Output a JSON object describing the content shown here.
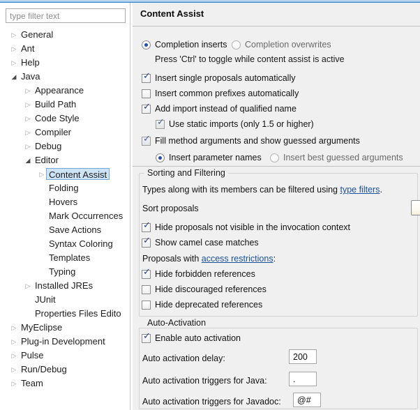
{
  "window": {
    "title_strip_color": "#5f9fd4"
  },
  "sidebar": {
    "filter": {
      "placeholder": "type filter text",
      "value": ""
    },
    "items": [
      {
        "label": "General",
        "level": 0,
        "twisty": "collapsed",
        "selected": false
      },
      {
        "label": "Ant",
        "level": 0,
        "twisty": "collapsed",
        "selected": false
      },
      {
        "label": "Help",
        "level": 0,
        "twisty": "collapsed",
        "selected": false
      },
      {
        "label": "Java",
        "level": 0,
        "twisty": "expanded",
        "selected": false
      },
      {
        "label": "Appearance",
        "level": 1,
        "twisty": "collapsed",
        "selected": false
      },
      {
        "label": "Build Path",
        "level": 1,
        "twisty": "collapsed",
        "selected": false
      },
      {
        "label": "Code Style",
        "level": 1,
        "twisty": "collapsed",
        "selected": false
      },
      {
        "label": "Compiler",
        "level": 1,
        "twisty": "collapsed",
        "selected": false
      },
      {
        "label": "Debug",
        "level": 1,
        "twisty": "collapsed",
        "selected": false
      },
      {
        "label": "Editor",
        "level": 1,
        "twisty": "expanded",
        "selected": false
      },
      {
        "label": "Content Assist",
        "level": 2,
        "twisty": "collapsed",
        "selected": true
      },
      {
        "label": "Folding",
        "level": 2,
        "twisty": "none",
        "selected": false
      },
      {
        "label": "Hovers",
        "level": 2,
        "twisty": "none",
        "selected": false
      },
      {
        "label": "Mark Occurrences",
        "level": 2,
        "twisty": "none",
        "selected": false
      },
      {
        "label": "Save Actions",
        "level": 2,
        "twisty": "none",
        "selected": false
      },
      {
        "label": "Syntax Coloring",
        "level": 2,
        "twisty": "none",
        "selected": false
      },
      {
        "label": "Templates",
        "level": 2,
        "twisty": "none",
        "selected": false
      },
      {
        "label": "Typing",
        "level": 2,
        "twisty": "none",
        "selected": false
      },
      {
        "label": "Installed JREs",
        "level": 1,
        "twisty": "collapsed",
        "selected": false
      },
      {
        "label": "JUnit",
        "level": 1,
        "twisty": "none",
        "selected": false
      },
      {
        "label": "Properties Files Edito",
        "level": 1,
        "twisty": "none",
        "selected": false
      },
      {
        "label": "MyEclipse",
        "level": 0,
        "twisty": "collapsed",
        "selected": false
      },
      {
        "label": "Plug-in Development",
        "level": 0,
        "twisty": "collapsed",
        "selected": false
      },
      {
        "label": "Pulse",
        "level": 0,
        "twisty": "collapsed",
        "selected": false
      },
      {
        "label": "Run/Debug",
        "level": 0,
        "twisty": "collapsed",
        "selected": false
      },
      {
        "label": "Team",
        "level": 0,
        "twisty": "collapsed",
        "selected": false
      }
    ]
  },
  "page": {
    "title": "Content Assist",
    "insertion": {
      "completion_inserts": {
        "label": "Completion inserts",
        "checked": true
      },
      "completion_overwrites": {
        "label": "Completion overwrites",
        "checked": false
      },
      "hint": "Press 'Ctrl' to toggle while content assist is active"
    },
    "options": [
      {
        "label": "Insert single proposals automatically",
        "checked": true,
        "indent": 0,
        "enabled": true
      },
      {
        "label": "Insert common prefixes automatically",
        "checked": false,
        "indent": 0,
        "enabled": true
      },
      {
        "label": "Add import instead of qualified name",
        "checked": true,
        "indent": 0,
        "enabled": true
      },
      {
        "label": "Use static imports (only 1.5 or higher)",
        "checked": true,
        "indent": 1,
        "enabled": false
      },
      {
        "label": "Fill method arguments and show guessed arguments",
        "checked": true,
        "indent": 0,
        "enabled": false
      }
    ],
    "fill_mode": {
      "insert_parameter_names": {
        "label": "Insert parameter names",
        "checked": true
      },
      "insert_best_guessed_arguments": {
        "label": "Insert best guessed arguments",
        "checked": false
      }
    },
    "sorting_and_filtering": {
      "title": "Sorting and Filtering",
      "filter_note_before": "Types along with its members can be filtered using ",
      "filter_note_link": "type filters",
      "filter_note_after": ".",
      "sort_proposals_label": "Sort proposals",
      "sort_proposals_value": "",
      "checks": [
        {
          "label": "Hide proposals not visible in the invocation context",
          "checked": true
        },
        {
          "label": "Show camel case matches",
          "checked": true
        }
      ],
      "access_restrictions_before": "Proposals with ",
      "access_restrictions_link": "access restrictions",
      "access_restrictions_after": ":",
      "restriction_checks": [
        {
          "label": "Hide forbidden references",
          "checked": true
        },
        {
          "label": "Hide discouraged references",
          "checked": false
        },
        {
          "label": "Hide deprecated references",
          "checked": false
        }
      ]
    },
    "auto_activation": {
      "title": "Auto-Activation",
      "enable": {
        "label": "Enable auto activation",
        "checked": true
      },
      "fields": [
        {
          "label": "Auto activation delay:",
          "value": "200",
          "width": 40
        },
        {
          "label": "Auto activation triggers for Java:",
          "value": ".",
          "width": 40
        },
        {
          "label": "Auto activation triggers for Javadoc:",
          "value": "@#",
          "width": 40
        }
      ]
    }
  }
}
